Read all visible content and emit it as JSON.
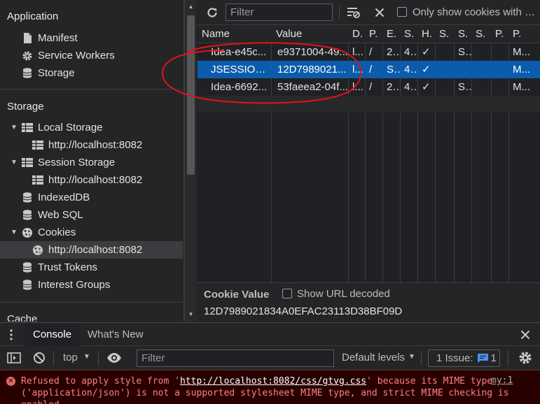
{
  "sidebar": {
    "application": {
      "title": "Application",
      "items": [
        {
          "label": "Manifest",
          "icon": "document-icon"
        },
        {
          "label": "Service Workers",
          "icon": "gear-icon"
        },
        {
          "label": "Storage",
          "icon": "database-icon"
        }
      ]
    },
    "storage": {
      "title": "Storage",
      "items": [
        {
          "label": "Local Storage",
          "icon": "table-icon",
          "expanded": true
        },
        {
          "label": "http://localhost:8082",
          "icon": "table-icon"
        },
        {
          "label": "Session Storage",
          "icon": "table-icon",
          "expanded": true
        },
        {
          "label": "http://localhost:8082",
          "icon": "table-icon"
        },
        {
          "label": "IndexedDB",
          "icon": "database-icon"
        },
        {
          "label": "Web SQL",
          "icon": "database-icon"
        },
        {
          "label": "Cookies",
          "icon": "cookie-icon",
          "expanded": true
        },
        {
          "label": "http://localhost:8082",
          "icon": "cookie-icon",
          "selected": true
        },
        {
          "label": "Trust Tokens",
          "icon": "database-icon"
        },
        {
          "label": "Interest Groups",
          "icon": "database-icon"
        }
      ]
    },
    "cache": {
      "title": "Cache"
    }
  },
  "toolbar": {
    "filter_placeholder": "Filter",
    "only_issues_label": "Only show cookies with an issue"
  },
  "cookies_table": {
    "headers": [
      "Name",
      "Value",
      "D.",
      "P.",
      "E.",
      "S.",
      "H.",
      "S.",
      "S.",
      "S.",
      "P.",
      "P."
    ],
    "rows": [
      [
        "Idea-e45c...",
        "e9371004-49...",
        "l...",
        "/",
        "2...",
        "4...",
        "✓",
        "",
        "S...",
        "",
        "",
        "M..."
      ],
      [
        "JSESSIONID",
        "12D7989021...",
        "l...",
        "/",
        "S...",
        "4...",
        "✓",
        "",
        "",
        "",
        "",
        "M..."
      ],
      [
        "Idea-6692...",
        "53faeea2-04f...",
        "l...",
        "/",
        "2...",
        "4...",
        "✓",
        "",
        "S...",
        "",
        "",
        "M..."
      ]
    ],
    "selected_row": 1
  },
  "cookie_value": {
    "title": "Cookie Value",
    "show_url_decoded_label": "Show URL decoded",
    "value": "12D7989021834A0EFAC23113D38BF09D"
  },
  "drawer": {
    "tabs": [
      "Console",
      "What's New"
    ],
    "active_tab": "Console",
    "console_bar": {
      "context": "top",
      "filter_placeholder": "Filter",
      "levels": "Default levels",
      "issues_label": "1 Issue:",
      "issues_count": "1"
    },
    "messages": [
      {
        "level": "error",
        "prefix": "Refused to apply style from '",
        "url": "http://localhost:8082/css/gtvg.css",
        "suffix": "' because its MIME type ('application/json') is not a supported stylesheet MIME type, and strict MIME checking is enabled.",
        "source": "my:1"
      }
    ]
  },
  "colors": {
    "selection": "#0b5cad",
    "annotation": "#e0141c",
    "error_bg": "#290000",
    "error_text": "#ff8080"
  }
}
